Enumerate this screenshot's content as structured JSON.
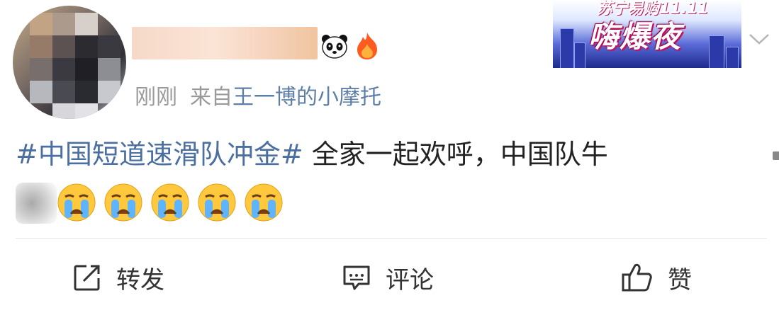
{
  "post": {
    "meta": {
      "time": "刚刚",
      "source_prefix": "来自",
      "source": "王一博的小摩托"
    },
    "banner": {
      "top_text": "苏宁易购11.11",
      "title": "嗨爆夜"
    },
    "content": {
      "hashtag": "#中国短道速滑队冲金#",
      "text": " 全家一起欢呼，中国队牛"
    },
    "emojis": [
      "crying-face",
      "crying-face",
      "crying-face",
      "crying-face",
      "crying-face"
    ],
    "actions": {
      "repost_label": "转发",
      "comment_label": "评论",
      "like_label": "赞"
    }
  },
  "colors": {
    "link": "#4c6fa1",
    "meta_text": "#9a9a9a",
    "source": "#5d7fa6",
    "body_text": "#222222"
  }
}
